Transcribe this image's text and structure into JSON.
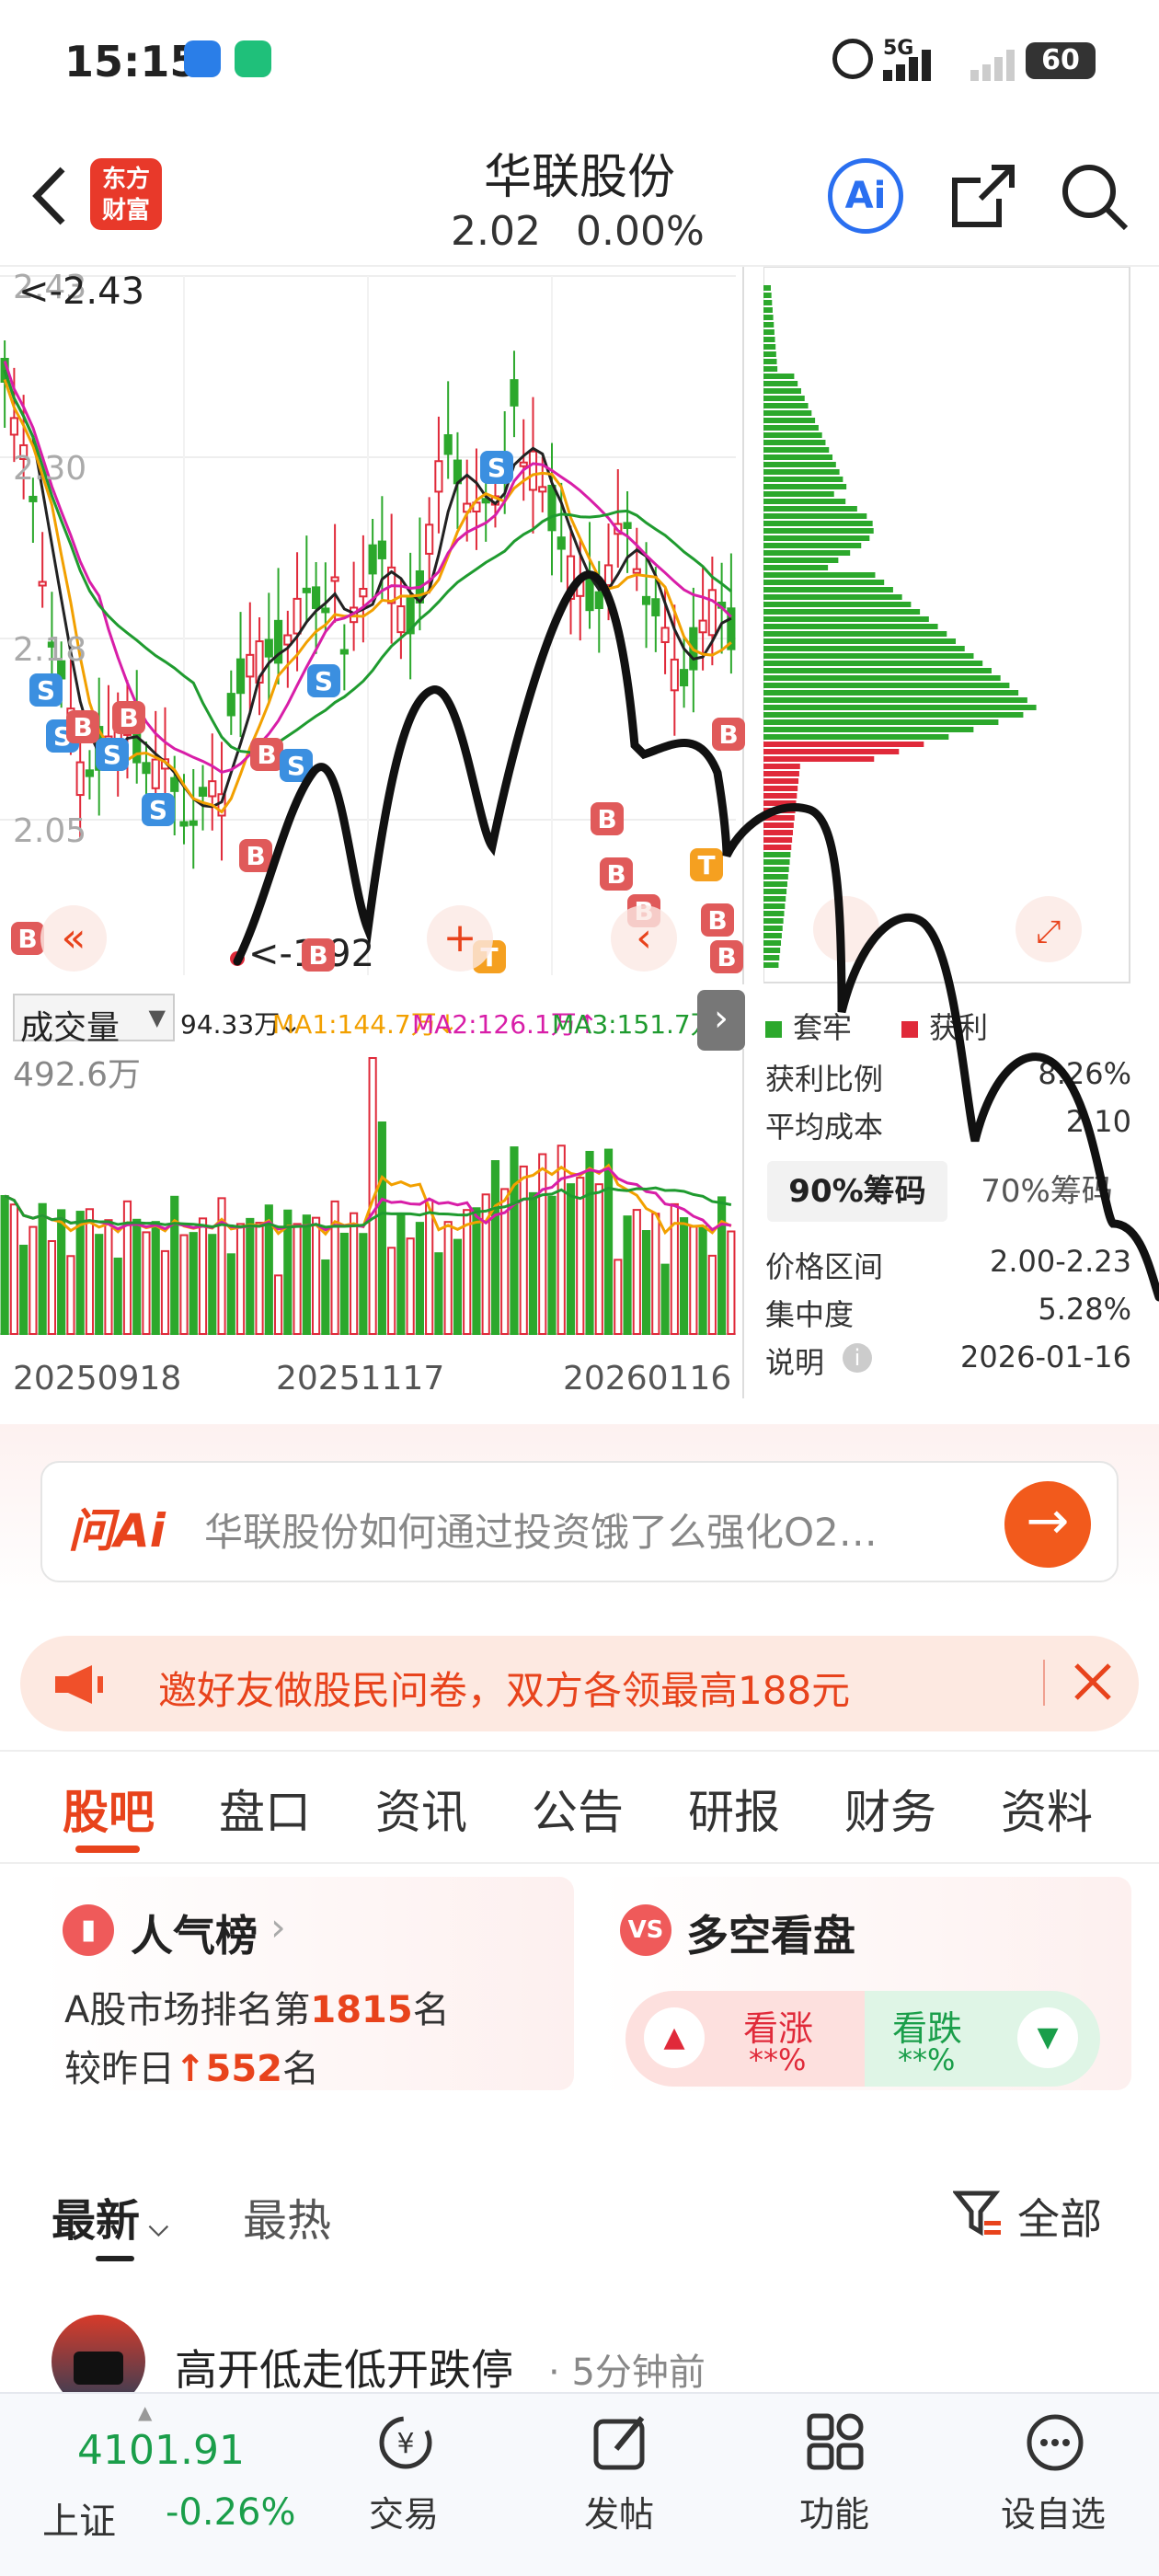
{
  "status": {
    "time": "15:15",
    "battery": "60",
    "net": "5G"
  },
  "header": {
    "logo": "东方\n财富",
    "name": "华联股份",
    "price": "2.02",
    "change": "0.00%"
  },
  "chart_data": {
    "type": "candlestick",
    "price_ticks": [
      "2.43",
      "2.30",
      "2.18",
      "2.05",
      "1.92"
    ],
    "max_label": "<-2.43",
    "min_label": "<-1.92",
    "dates": [
      "20250918",
      "20251117",
      "20260116"
    ],
    "volume_label": "成交量",
    "volume_max": "492.6万",
    "vol_legend": {
      "vol": "94.33万↓",
      "ma1": "MA1:144.7万↓",
      "ma2": "MA2:126.1万↑",
      "ma3": "MA3:151.7万↓"
    },
    "colors": {
      "up": "#e02a3a",
      "down": "#2ca82c",
      "ma1": "#f2a000",
      "ma2": "#d81ea8",
      "ma3": "#1f9b2f",
      "ma0": "#222222"
    }
  },
  "chips": {
    "legend_trap": "套牢",
    "legend_profit": "获利",
    "rows": [
      {
        "label": "获利比例",
        "value": "8.26%"
      },
      {
        "label": "平均成本",
        "value": "2.10"
      }
    ],
    "tab90": "90%筹码",
    "tab70": "70%筹码",
    "rows2": [
      {
        "label": "价格区间",
        "value": "2.00-2.23"
      },
      {
        "label": "集中度",
        "value": "5.28%"
      },
      {
        "label": "说明",
        "value": "2026-01-16"
      }
    ]
  },
  "ai": {
    "brand": "问Ai",
    "placeholder": "华联股份如何通过投资饿了么强化O2…"
  },
  "banner": {
    "text": "邀好友做股民问卷，双方各领最高188元"
  },
  "tabs": [
    "股吧",
    "盘口",
    "资讯",
    "公告",
    "研报",
    "财务",
    "资料"
  ],
  "popular": {
    "title": "人气榜",
    "line1a": "A股市场排名第",
    "rank": "1815",
    "line1b": "名",
    "line2a": "较昨日",
    "delta": "552",
    "line2b": "名"
  },
  "vs": {
    "title": "多空看盘",
    "up": "看涨",
    "up_pct": "**%",
    "down": "看跌",
    "down_pct": "**%"
  },
  "feed": {
    "tab_new": "最新",
    "tab_hot": "最热",
    "filter": "全部"
  },
  "post": {
    "title": "高开低走低开跌停",
    "time": "5分钟前"
  },
  "bottom": {
    "index_value": "4101.91",
    "index_name": "上证",
    "index_change": "-0.26%",
    "items": [
      "交易",
      "发帖",
      "功能",
      "设自选"
    ]
  }
}
